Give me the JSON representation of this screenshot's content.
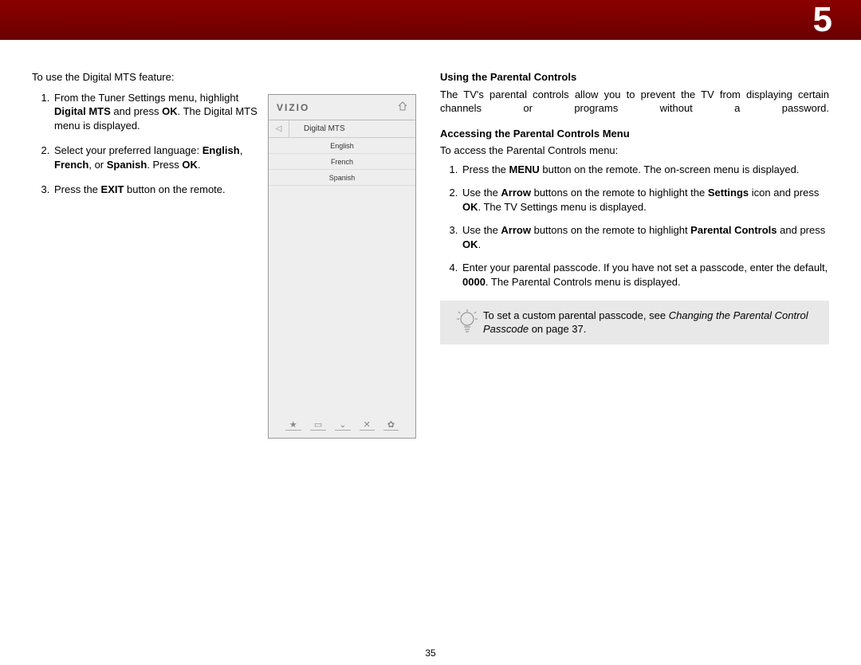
{
  "chapter_number": "5",
  "page_number": "35",
  "left": {
    "intro": "To use the Digital MTS feature:",
    "step1_a": "From the Tuner Settings menu, highlight ",
    "step1_b": "Digital MTS",
    "step1_c": " and press ",
    "step1_d": "OK",
    "step1_e": ". The Digital MTS menu is displayed.",
    "step2_a": "Select your preferred language: ",
    "step2_b": "English",
    "step2_c": ", ",
    "step2_d": "French",
    "step2_e": ", or ",
    "step2_f": "Spanish",
    "step2_g": ". Press ",
    "step2_h": "OK",
    "step2_i": ".",
    "step3_a": "Press the ",
    "step3_b": "EXIT",
    "step3_c": " button on the remote."
  },
  "screenshot": {
    "logo": "VIZIO",
    "title": "Digital MTS",
    "options": {
      "o1": "English",
      "o2": "French",
      "o3": "Spanish"
    },
    "icons": {
      "star": "★",
      "wide": "▭",
      "down": "⌄",
      "x": "✕",
      "gear": "✿"
    }
  },
  "right": {
    "section_title": "Using the Parental Controls",
    "para1": "The TV's parental controls allow you to prevent the TV from displaying certain channels or programs without a password.",
    "sub_title": "Accessing the Parental Controls Menu",
    "intro": "To access the Parental Controls menu:",
    "s1_a": "Press the ",
    "s1_b": "MENU",
    "s1_c": " button on the remote. The on-screen menu is displayed.",
    "s2_a": "Use the ",
    "s2_b": "Arrow",
    "s2_c": " buttons on the remote to highlight the ",
    "s2_d": "Settings",
    "s2_e": " icon and press ",
    "s2_f": "OK",
    "s2_g": ". The TV Settings menu is displayed.",
    "s3_a": "Use the ",
    "s3_b": "Arrow",
    "s3_c": " buttons on the remote to highlight ",
    "s3_d": "Parental Controls",
    "s3_e": " and press ",
    "s3_f": "OK",
    "s3_g": ".",
    "s4_a": "Enter your parental passcode. If you have not set a passcode, enter the default, ",
    "s4_b": "0000",
    "s4_c": ". The Parental Controls menu is displayed.",
    "tip_a": "To set a custom parental passcode, see ",
    "tip_b": "Changing the Parental Control Passcode",
    "tip_c": " on page 37."
  }
}
